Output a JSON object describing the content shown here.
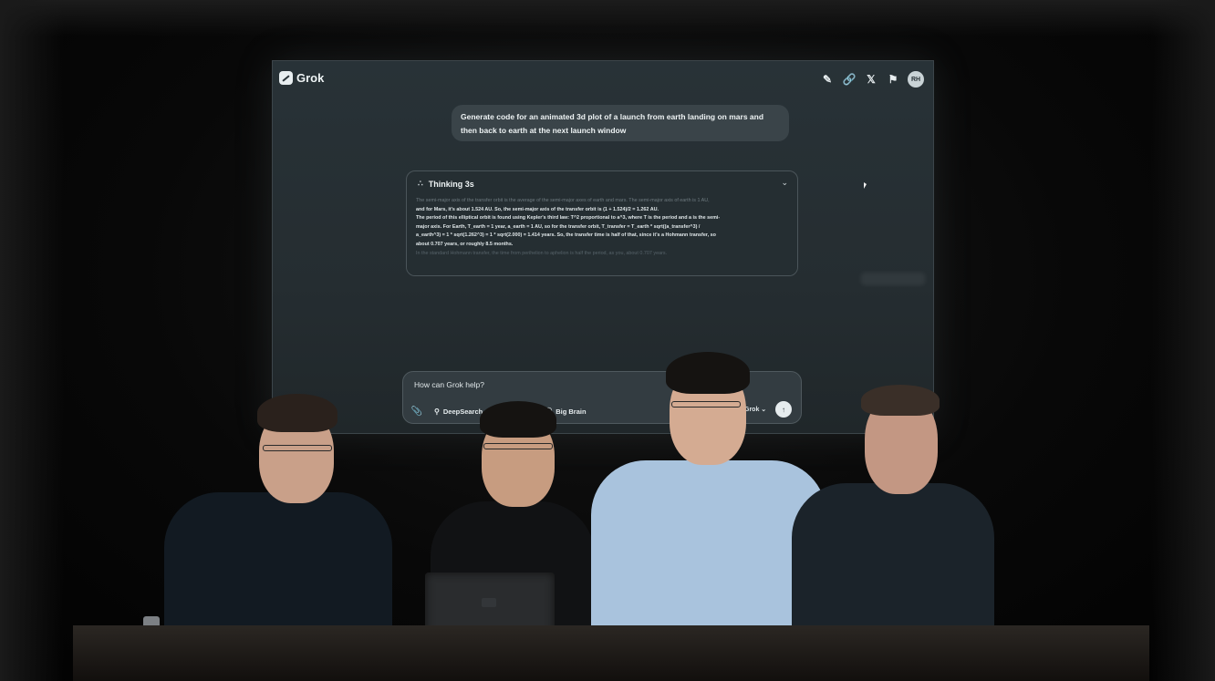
{
  "app": {
    "name": "Grok",
    "user_initials": "RH"
  },
  "topbar": {
    "icons": [
      "new-chat-icon",
      "link-icon",
      "x-logo-icon",
      "flag-icon"
    ]
  },
  "conversation": {
    "user_message": "Generate code for an animated 3d plot of a launch from earth landing on mars and then back to earth at the next launch window",
    "thinking": {
      "label": "Thinking 3s",
      "lines": [
        "The semi-major axis of the transfer orbit is the average of the semi-major axes of earth and mars. The semi-major axis of earth is 1 AU,",
        "and for Mars, it's about 1.524 AU. So, the semi-major axis of the transfer orbit is (1 + 1.524)/2 = 1.262 AU.",
        "The period of this elliptical orbit is found using Kepler's third law: T^2 proportional to a^3, where T is the period and a is the semi-",
        "major axis. For Earth, T_earth = 1 year, a_earth = 1 AU, so for the transfer orbit, T_transfer = T_earth * sqrt((a_transfer^3) /",
        "a_earth^3) = 1 * sqrt(1.262^3) = 1 * sqrt(2.000) = 1.414 years. So, the transfer time is half of that, since it's a Hohmann transfer, so",
        "about 0.707 years, or roughly 8.5 months.",
        "In the standard Hohmann transfer, the time from perihelion to aphelion is half the period, as you, about 0.707 years."
      ]
    }
  },
  "composer": {
    "placeholder": "How can Grok help?",
    "deepsearch_label": "DeepSearch",
    "bigbrain_label": "Big Brain",
    "model_label": "Grok"
  }
}
